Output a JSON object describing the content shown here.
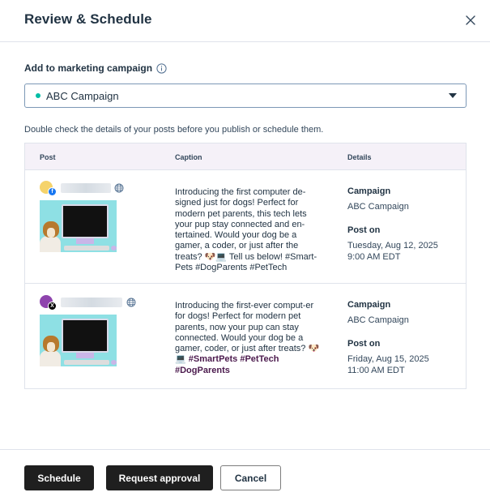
{
  "dialog": {
    "title": "Review & Schedule"
  },
  "campaign": {
    "label": "Add to marketing campaign",
    "selected": "ABC Campaign",
    "dot_color": "#00bda5"
  },
  "helper_text": "Double check the details of your posts before you publish or schedule them.",
  "table": {
    "headers": {
      "post": "Post",
      "caption": "Caption",
      "details": "Details"
    },
    "rows": [
      {
        "network": "facebook",
        "badge_letter": "f",
        "badge_color": "#1877f2",
        "avatar_color": "#f5d36b",
        "caption_text": "Introducing the first computer de-signed just for dogs! Perfect for modern pet parents, this tech lets your pup stay connected and en-tertained. Would your dog be a gamer, a coder, or just after the treats? 🐶💻 Tell us below! #Smart-Pets #DogParents #PetTech",
        "caption_tags": "",
        "campaign_label": "Campaign",
        "campaign_value": "ABC Campaign",
        "post_on_label": "Post on",
        "post_on_date": "Tuesday, Aug 12, 2025",
        "post_on_time": "9:00 AM EDT"
      },
      {
        "network": "x",
        "badge_letter": "X",
        "badge_color": "#000000",
        "avatar_color": "#8e44ad",
        "caption_text": "Introducing the first-ever comput-er for dogs! Perfect for modern pet parents, now your pup can stay connected. Would your dog be a gamer, coder, or just after treats? 🐶💻 ",
        "caption_tags": "#SmartPets #PetTech #DogParents",
        "campaign_label": "Campaign",
        "campaign_value": "ABC Campaign",
        "post_on_label": "Post on",
        "post_on_date": "Friday, Aug 15, 2025",
        "post_on_time": "11:00 AM EDT"
      }
    ]
  },
  "footer": {
    "schedule_label": "Schedule",
    "request_approval_label": "Request approval",
    "cancel_label": "Cancel"
  },
  "icons": {
    "close": "close-icon",
    "info": "info-icon",
    "dropdown": "chevron-down-icon",
    "globe": "globe-icon"
  }
}
